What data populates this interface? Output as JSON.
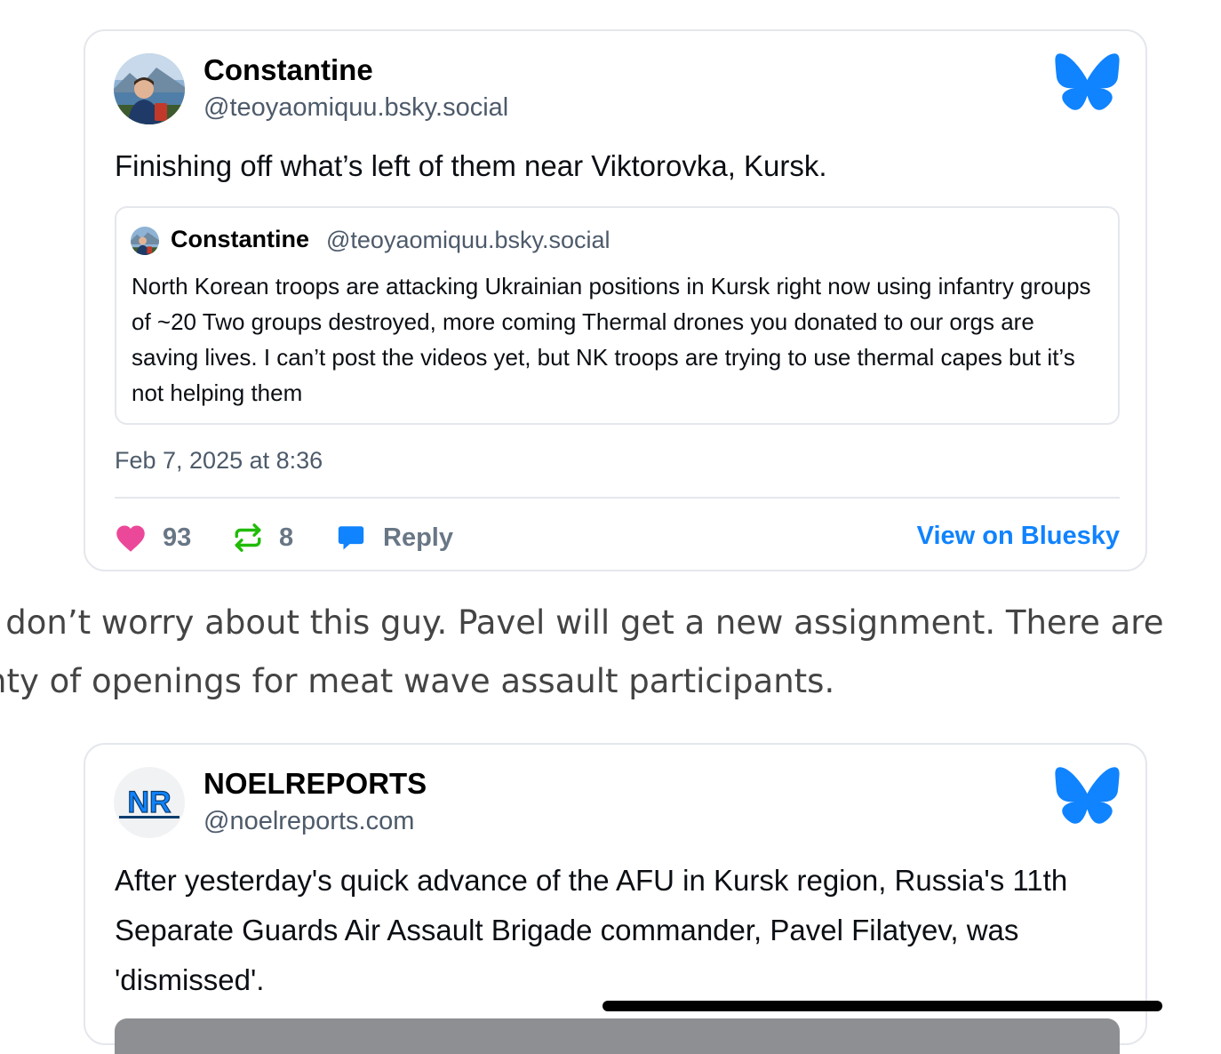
{
  "posts": [
    {
      "author": {
        "name": "Constantine",
        "handle": "@teoyaomiquu.bsky.social"
      },
      "text": "Finishing off what’s left of them near Viktorovka, Kursk.",
      "quote": {
        "author_name": "Constantine",
        "author_handle": "@teoyaomiquu.bsky.social",
        "text": "North Korean troops are attacking Ukrainian positions in Kursk right now using infantry groups of ~20 Two groups destroyed, more coming Thermal drones you donated to our orgs are saving lives. I can’t post the videos yet, but NK troops are trying to use thermal capes but it’s not helping them"
      },
      "timestamp": "Feb 7, 2025 at 8:36",
      "likes": "93",
      "reposts": "8",
      "reply_label": "Reply",
      "view_label": "View on Bluesky"
    },
    {
      "author": {
        "name": "NOELREPORTS",
        "handle": "@noelreports.com",
        "logo_text": "NR"
      },
      "text": "After yesterday's quick advance of the AFU in Kursk region, Russia's 11th Separate Guards Air Assault Brigade commander, Pavel Filatyev, was 'dismissed'."
    }
  ],
  "article": {
    "line1": "t don’t worry about this guy. Pavel will get a new assignment. There are",
    "line2": "nty of openings for meat wave assault participants."
  },
  "colors": {
    "bluesky_blue": "#1083fe",
    "like_pink": "#ec4899",
    "repost_green": "#20bc07",
    "reply_blue": "#1083fe"
  },
  "icons": {
    "bluesky": "butterfly-icon",
    "like": "heart-icon",
    "repost": "repost-icon",
    "reply": "speech-bubble-icon"
  }
}
